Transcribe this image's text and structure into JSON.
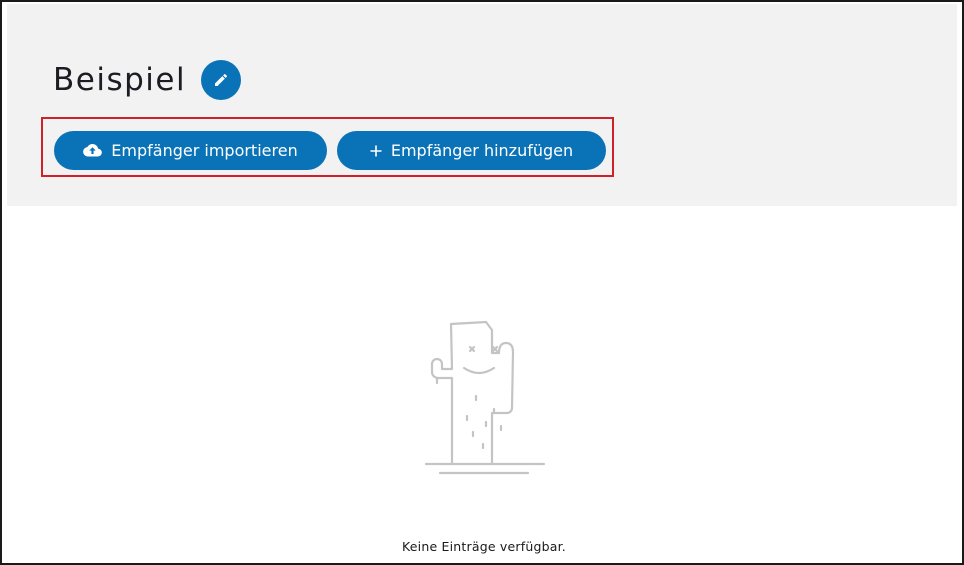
{
  "page": {
    "title": "Beispiel"
  },
  "header": {
    "edit_icon": "pencil-icon"
  },
  "toolbar": {
    "import_label": "Empfänger importieren",
    "import_icon": "cloud-upload-icon",
    "add_label": "Empfänger hinzufügen",
    "add_icon": "plus-icon"
  },
  "empty_state": {
    "illustration": "cactus-icon",
    "message": "Keine Einträge verfügbar."
  },
  "colors": {
    "accent": "#0a73b8",
    "highlight_border": "#d0202a",
    "header_background": "#f2f2f2",
    "illustration": "#c4c4c4"
  }
}
